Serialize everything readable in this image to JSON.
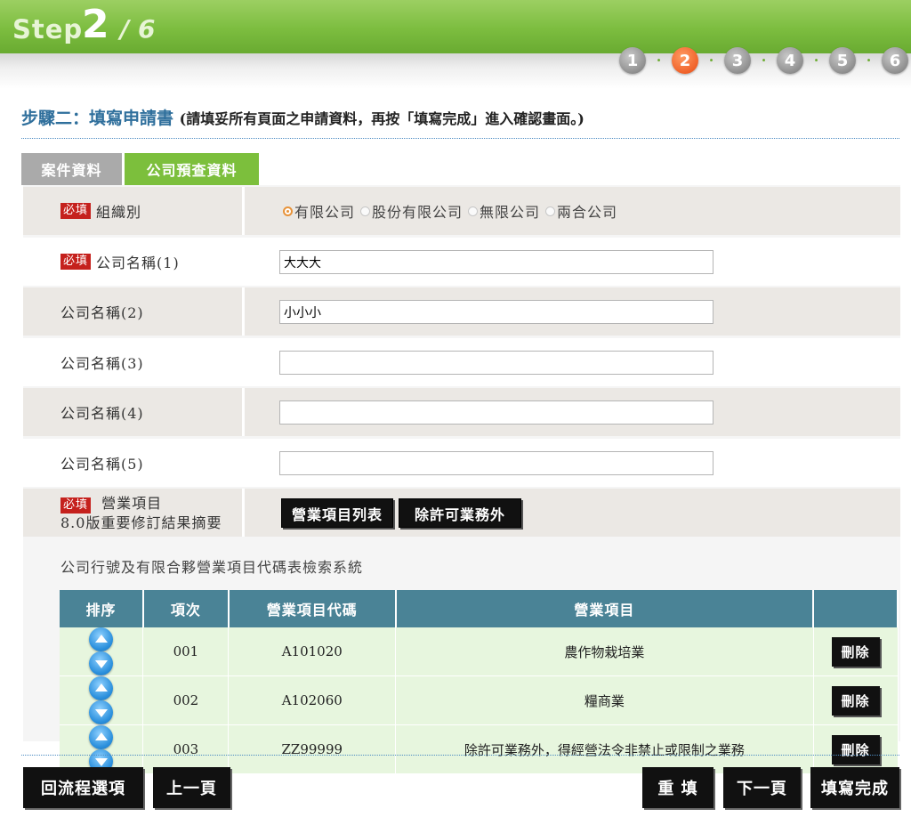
{
  "header": {
    "step_word": "Step",
    "current_step": "2",
    "total_steps": "/ 6",
    "steps": [
      "1",
      "2",
      "3",
      "4",
      "5",
      "6"
    ],
    "active_step_index": 1
  },
  "title": {
    "main": "步驟二：填寫申請書",
    "note": "(請填妥所有頁面之申請資料，再按「填寫完成」進入確認畫面。)"
  },
  "tabs": {
    "case_data": "案件資料",
    "company_precheck": "公司預查資料"
  },
  "required_badge": "必填",
  "form": {
    "org_type_label": "組織別",
    "org_types": [
      "有限公司",
      "股份有限公司",
      "無限公司",
      "兩合公司"
    ],
    "org_type_selected": 0,
    "name1_label": "公司名稱(1)",
    "name1_value": "大大大",
    "name2_label": "公司名稱(2)",
    "name2_value": "小小小",
    "name3_label": "公司名稱(3)",
    "name3_value": "",
    "name4_label": "公司名稱(4)",
    "name4_value": "",
    "name5_label": "公司名稱(5)",
    "name5_value": "",
    "business_label": "營業項目",
    "business_sub_label": "8.0版重要修訂結果摘要",
    "btn_business_list": "營業項目列表",
    "btn_except_permit": "除許可業務外",
    "search_caption": "公司行號及有限合夥營業項目代碼表檢索系統"
  },
  "table": {
    "headers": [
      "排序",
      "項次",
      "營業項目代碼",
      "營業項目",
      ""
    ],
    "delete_label": "刪除",
    "rows": [
      {
        "no": "001",
        "code": "A101020",
        "item": "農作物栽培業"
      },
      {
        "no": "002",
        "code": "A102060",
        "item": "糧商業"
      },
      {
        "no": "003",
        "code": "ZZ99999",
        "item": "除許可業務外，得經營法令非禁止或限制之業務"
      }
    ]
  },
  "footer": {
    "back_to_flow": "回流程選項",
    "prev_page": "上一頁",
    "reset": "重 填",
    "next_page": "下一頁",
    "finish": "填寫完成"
  },
  "colors": {
    "header_green": "#7cbd3f",
    "active_step_orange": "#f0622a",
    "title_blue": "#2f6f9c",
    "required_red": "#c5211d",
    "table_header": "#4a8396"
  }
}
